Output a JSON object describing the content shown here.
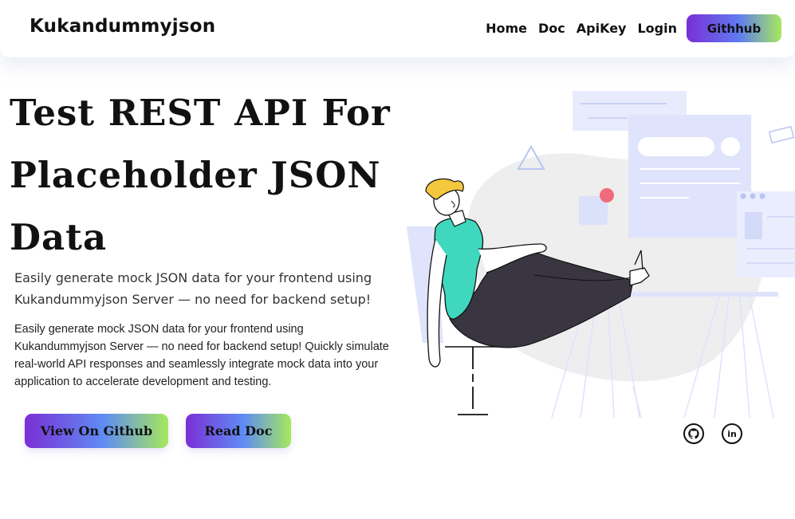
{
  "brand": "Kukandummyjson",
  "nav": {
    "links": [
      "Home",
      "Doc",
      "ApiKey",
      "Login"
    ],
    "cta": "Githhub"
  },
  "hero": {
    "title": "Test REST API For Placeholder JSON Data",
    "subtitle": "Easily generate mock JSON data for your frontend using Kukandummyjson Server — no need for backend setup!",
    "description": "Easily generate mock JSON data for your frontend using Kukandummyjson Server — no need for backend setup! Quickly simulate real-world API responses and seamlessly integrate mock data into your application to accelerate development and testing.",
    "buttons": {
      "github": "View On Github",
      "doc": "Read Doc"
    }
  },
  "social": {
    "github_icon": "github-icon",
    "linkedin_icon": "linkedin-icon",
    "linkedin_glyph": "in"
  },
  "colors": {
    "gradient_start": "#7a2fd6",
    "gradient_mid": "#5f8cf4",
    "gradient_end": "#a6e85c",
    "illustration_panel": "#dfe3fb",
    "person_shirt": "#3fd8bf",
    "person_hair": "#f3c73e",
    "accent_dot": "#f06b7b"
  }
}
